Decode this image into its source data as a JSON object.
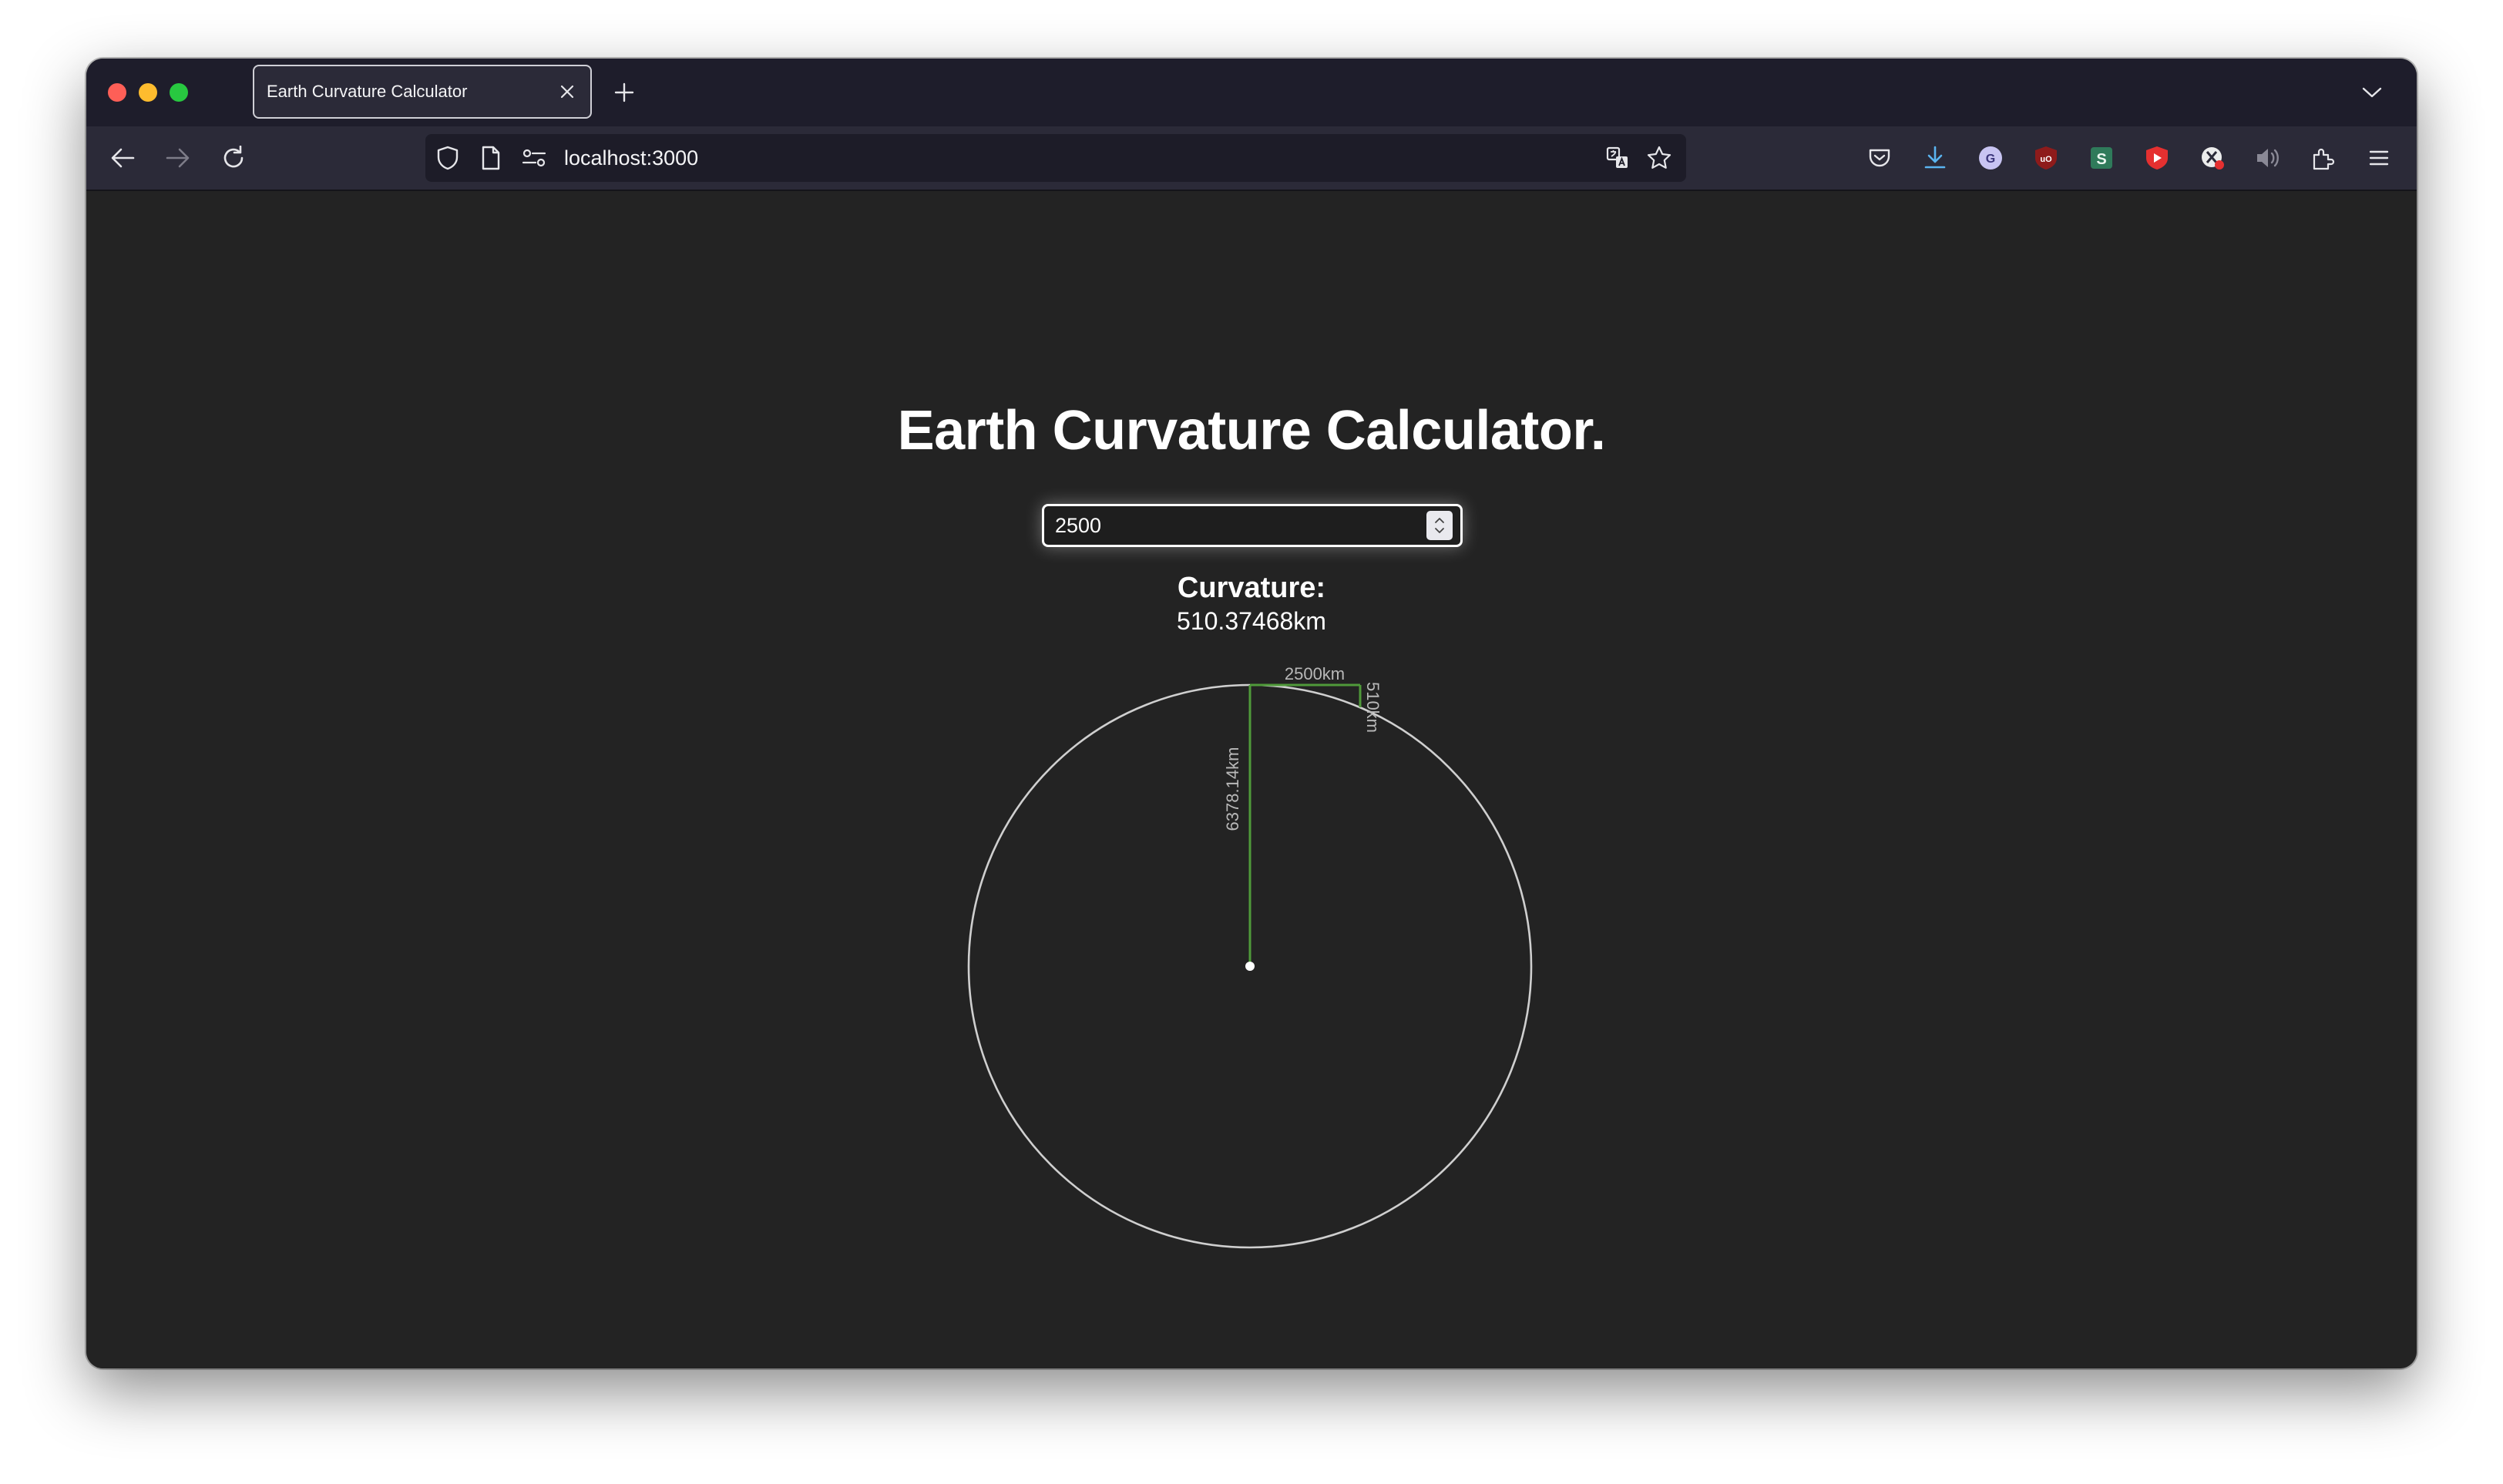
{
  "browser": {
    "tab_title": "Earth Curvature Calculator",
    "url": "localhost:3000",
    "icons": {
      "back": "arrow-left-icon",
      "forward": "arrow-right-icon",
      "reload": "reload-icon",
      "tracking_protection": "shield-icon",
      "page_info": "page-icon",
      "permissions": "permissions-icon",
      "translate": "translate-icon",
      "bookmark": "star-icon",
      "pocket": "pocket-icon",
      "downloads": "download-icon",
      "extensions": "puzzle-icon",
      "menu": "hamburger-menu-icon"
    },
    "extension_badges": {
      "grammarly": "G",
      "ublock": "uO",
      "s_ext": "S"
    }
  },
  "page": {
    "title": "Earth Curvature Calculator.",
    "distance_input": {
      "value": "2500"
    },
    "curvature_label": "Curvature:",
    "curvature_value": "510.37468km"
  },
  "diagram": {
    "radius_label": "6378.14km",
    "distance_label": "2500km",
    "drop_label": "510km",
    "colors": {
      "circle": "#cfcfcf",
      "line": "#4f9a3a",
      "center": "#ffffff"
    }
  }
}
